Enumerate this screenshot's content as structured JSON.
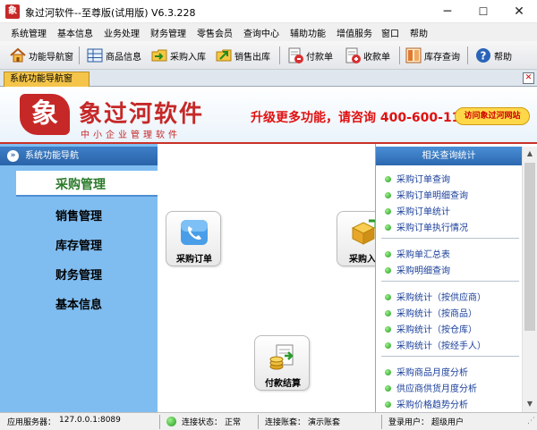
{
  "window": {
    "title": "象过河软件--至尊版(试用版) V6.3.228",
    "minimize": "─",
    "maximize": "☐",
    "close": "✕"
  },
  "menu": [
    "系统管理",
    "基本信息",
    "业务处理",
    "财务管理",
    "零售会员",
    "查询中心",
    "辅助功能",
    "增值服务",
    "窗口",
    "帮助"
  ],
  "toolbar": {
    "buttons": [
      {
        "label": "功能导航窗",
        "icon": "home-icon"
      },
      {
        "label": "商品信息",
        "icon": "product-grid-icon"
      },
      {
        "label": "采购入库",
        "icon": "purchase-in-icon"
      },
      {
        "label": "销售出库",
        "icon": "sales-out-icon"
      },
      {
        "label": "付款单",
        "icon": "payment-icon"
      },
      {
        "label": "收款单",
        "icon": "receipt-icon"
      },
      {
        "label": "库存查询",
        "icon": "inventory-icon"
      },
      {
        "label": "帮助",
        "icon": "help-icon"
      }
    ]
  },
  "tabs": {
    "active_label": "系统功能导航窗",
    "close": "✕"
  },
  "banner": {
    "logo_glyph": "象",
    "brand_name": "象过河软件",
    "brand_sub": "中小企业管理软件",
    "promo": "升级更多功能，请咨询 400-600-1168",
    "visit_button": "访问象过河网站"
  },
  "nav": {
    "header": "系统功能导航",
    "header_icon": "»",
    "active_item": "采购管理",
    "items": [
      "销售管理",
      "库存管理",
      "财务管理",
      "基本信息"
    ]
  },
  "content": {
    "buttons": [
      {
        "label": "采购订单",
        "icon": "phone-order-icon"
      },
      {
        "label": "采购入",
        "icon": "box-stock-icon"
      },
      {
        "label": "付款结算",
        "icon": "coins-settlement-icon"
      }
    ]
  },
  "right_panel": {
    "title": "相关查询统计",
    "groups": [
      [
        "采购订单查询",
        "采购订单明细查询",
        "采购订单统计",
        "采购订单执行情况"
      ],
      [
        "采购单汇总表",
        "采购明细查询"
      ],
      [
        "采购统计（按供应商）",
        "采购统计（按商品）",
        "采购统计（按仓库）",
        "采购统计（按经手人）"
      ],
      [
        "采购商品月度分析",
        "供应商供货月度分析",
        "采购价格趋势分析"
      ]
    ],
    "scroll_up": "▲",
    "scroll_down": "▼"
  },
  "status": {
    "server_label": "应用服务器：",
    "server_value": "127.0.0.1:8089",
    "conn_label": "连接状态：",
    "conn_value": "正常",
    "account_label": "连接账套：",
    "account_value": "演示账套",
    "user_label": "登录用户：",
    "user_value": "超级用户",
    "grip": "⋰"
  },
  "colors": {
    "brand_red": "#c62828",
    "nav_blue": "#7fbdf1",
    "tab_yellow": "#f4c54a",
    "link_blue": "#1a3f9a",
    "status_green": "#1f9a1f"
  }
}
